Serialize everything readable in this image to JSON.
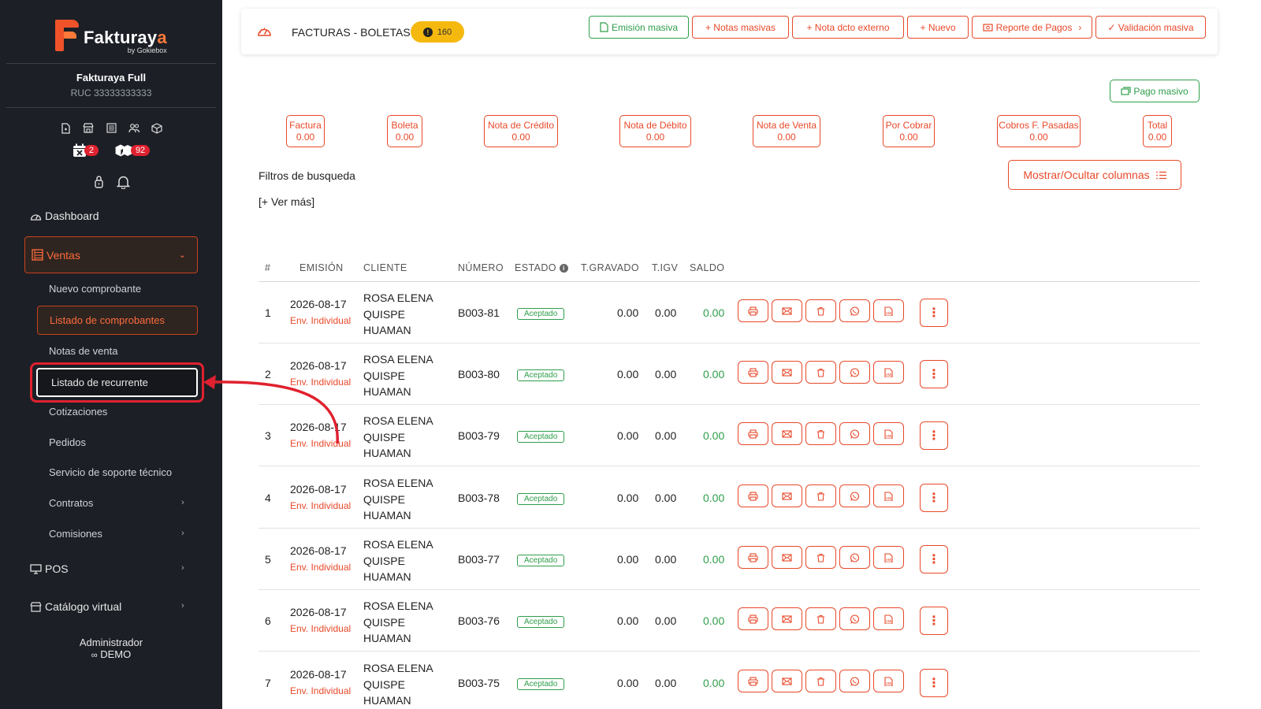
{
  "brand": {
    "name_a": "Fakturay",
    "name_b": "a",
    "tagline": "by Gokiebox"
  },
  "company": {
    "name": "Fakturaya Full",
    "ruc": "RUC 33333333333"
  },
  "badges": {
    "calendar": "2",
    "boxes": "92"
  },
  "sidebar": {
    "dashboard": "Dashboard",
    "ventas": "Ventas",
    "sub": {
      "nuevo": "Nuevo comprobante",
      "listado": "Listado de comprobantes",
      "notas": "Notas de venta",
      "recurrente": "Listado de recurrente",
      "cotizaciones": "Cotizaciones",
      "pedidos": "Pedidos",
      "soporte": "Servicio de soporte técnico",
      "contratos": "Contratos",
      "comisiones": "Comisiones"
    },
    "pos": "POS",
    "catalogo": "Catálogo virtual",
    "admin_role": "Administrador",
    "admin_user": "DEMO"
  },
  "header": {
    "title": "FACTURAS - BOLETAS",
    "count": "160",
    "buttons": {
      "emision": "Emisión masiva",
      "notas": "+ Notas masivas",
      "nota_ext": "+ Nota dcto externo",
      "nuevo": "+ Nuevo",
      "reporte": "Reporte de Pagos",
      "validacion": "✓ Validación masiva"
    }
  },
  "pago_masivo": "Pago masivo",
  "summary": {
    "factura": {
      "label": "Factura",
      "value": "0.00"
    },
    "boleta": {
      "label": "Boleta",
      "value": "0.00"
    },
    "credito": {
      "label": "Nota de Crédito",
      "value": "0.00"
    },
    "debito": {
      "label": "Nota de Débito",
      "value": "0.00"
    },
    "venta": {
      "label": "Nota de Venta",
      "value": "0.00"
    },
    "cobrar": {
      "label": "Por Cobrar",
      "value": "0.00"
    },
    "cobros": {
      "label": "Cobros F. Pasadas",
      "value": "0.00"
    },
    "total": {
      "label": "Total",
      "value": "0.00"
    }
  },
  "filters": {
    "title": "Filtros de busqueda",
    "more": "[+ Ver más]",
    "toggle_columns": "Mostrar/Ocultar columnas"
  },
  "table": {
    "headers": {
      "idx": "#",
      "emision": "EMISIÓN",
      "cliente": "CLIENTE",
      "numero": "NÚMERO",
      "estado": "ESTADO",
      "gravado": "T.GRAVADO",
      "igv": "T.IGV",
      "saldo": "SALDO"
    },
    "rows": [
      {
        "idx": "1",
        "date": "2026-08-17",
        "env": "Env. Individual",
        "c1": "ROSA ELENA",
        "c2": "QUISPE",
        "c3": "HUAMAN",
        "numero": "B003-81",
        "estado": "Aceptado",
        "gravado": "0.00",
        "igv": "0.00",
        "saldo": "0.00"
      },
      {
        "idx": "2",
        "date": "2026-08-17",
        "env": "Env. Individual",
        "c1": "ROSA ELENA",
        "c2": "QUISPE",
        "c3": "HUAMAN",
        "numero": "B003-80",
        "estado": "Aceptado",
        "gravado": "0.00",
        "igv": "0.00",
        "saldo": "0.00"
      },
      {
        "idx": "3",
        "date": "2026-08-17",
        "env": "Env. Individual",
        "c1": "ROSA ELENA",
        "c2": "QUISPE",
        "c3": "HUAMAN",
        "numero": "B003-79",
        "estado": "Aceptado",
        "gravado": "0.00",
        "igv": "0.00",
        "saldo": "0.00"
      },
      {
        "idx": "4",
        "date": "2026-08-17",
        "env": "Env. Individual",
        "c1": "ROSA ELENA",
        "c2": "QUISPE",
        "c3": "HUAMAN",
        "numero": "B003-78",
        "estado": "Aceptado",
        "gravado": "0.00",
        "igv": "0.00",
        "saldo": "0.00"
      },
      {
        "idx": "5",
        "date": "2026-08-17",
        "env": "Env. Individual",
        "c1": "ROSA ELENA",
        "c2": "QUISPE",
        "c3": "HUAMAN",
        "numero": "B003-77",
        "estado": "Aceptado",
        "gravado": "0.00",
        "igv": "0.00",
        "saldo": "0.00"
      },
      {
        "idx": "6",
        "date": "2026-08-17",
        "env": "Env. Individual",
        "c1": "ROSA ELENA",
        "c2": "QUISPE",
        "c3": "HUAMAN",
        "numero": "B003-76",
        "estado": "Aceptado",
        "gravado": "0.00",
        "igv": "0.00",
        "saldo": "0.00"
      },
      {
        "idx": "7",
        "date": "2026-08-17",
        "env": "Env. Individual",
        "c1": "ROSA ELENA",
        "c2": "QUISPE",
        "c3": "HUAMAN",
        "numero": "B003-75",
        "estado": "Aceptado",
        "gravado": "0.00",
        "igv": "0.00",
        "saldo": "0.00"
      }
    ]
  },
  "colors": {
    "accent": "#e8492a",
    "success": "#2e9e4a",
    "sidebar_bg": "#1c1f26",
    "highlight": "#e0212f",
    "warning": "#f5b80f"
  }
}
